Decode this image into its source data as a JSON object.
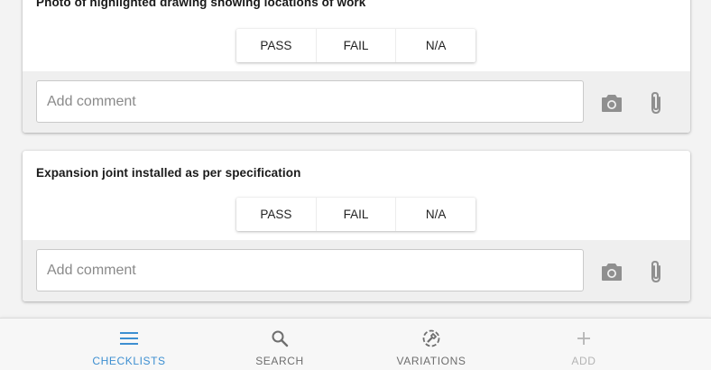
{
  "checklist_items": [
    {
      "title": "Photo of highlighted drawing showing locations of work",
      "options": [
        "PASS",
        "FAIL",
        "N/A"
      ],
      "comment_placeholder": "Add comment"
    },
    {
      "title": "Expansion joint installed as per specification",
      "options": [
        "PASS",
        "FAIL",
        "N/A"
      ],
      "comment_placeholder": "Add comment"
    }
  ],
  "icons": {
    "camera": "camera-icon",
    "attach": "paperclip-icon"
  },
  "bottom_nav": {
    "items": [
      {
        "label": "CHECKLISTS",
        "icon": "menu-icon",
        "active": true
      },
      {
        "label": "SEARCH",
        "icon": "search-icon",
        "active": false
      },
      {
        "label": "VARIATIONS",
        "icon": "variations-icon",
        "active": false
      },
      {
        "label": "ADD",
        "icon": "plus-icon",
        "active": false,
        "disabled": true
      }
    ]
  },
  "colors": {
    "active": "#3d8fd1",
    "inactive": "#6e6e6e",
    "disabled": "#b4b4b4",
    "comment_bar": "#efefef"
  }
}
